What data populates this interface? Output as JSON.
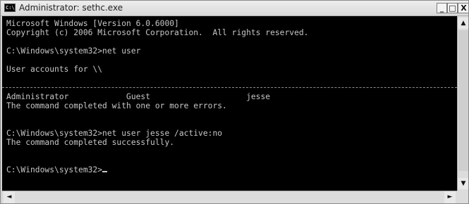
{
  "window": {
    "title": "Administrator: sethc.exe",
    "icon_text": "C:\\",
    "controls": {
      "minimize": "_",
      "maximize": "□",
      "close": "X"
    }
  },
  "console": {
    "lines": [
      "Microsoft Windows [Version 6.0.6000]",
      "Copyright (c) 2006 Microsoft Corporation.  All rights reserved.",
      "",
      "C:\\Windows\\system32>net user",
      "",
      "User accounts for \\\\",
      "",
      "-------------------------------------------------------------------------------",
      "Administrator            Guest                    jesse",
      "The command completed with one or more errors.",
      "",
      "",
      "C:\\Windows\\system32>net user jesse /active:no",
      "The command completed successfully.",
      "",
      "",
      "C:\\Windows\\system32>"
    ]
  },
  "scrollbar": {
    "up": "▲",
    "down": "▼",
    "left": "◄",
    "right": "►"
  }
}
